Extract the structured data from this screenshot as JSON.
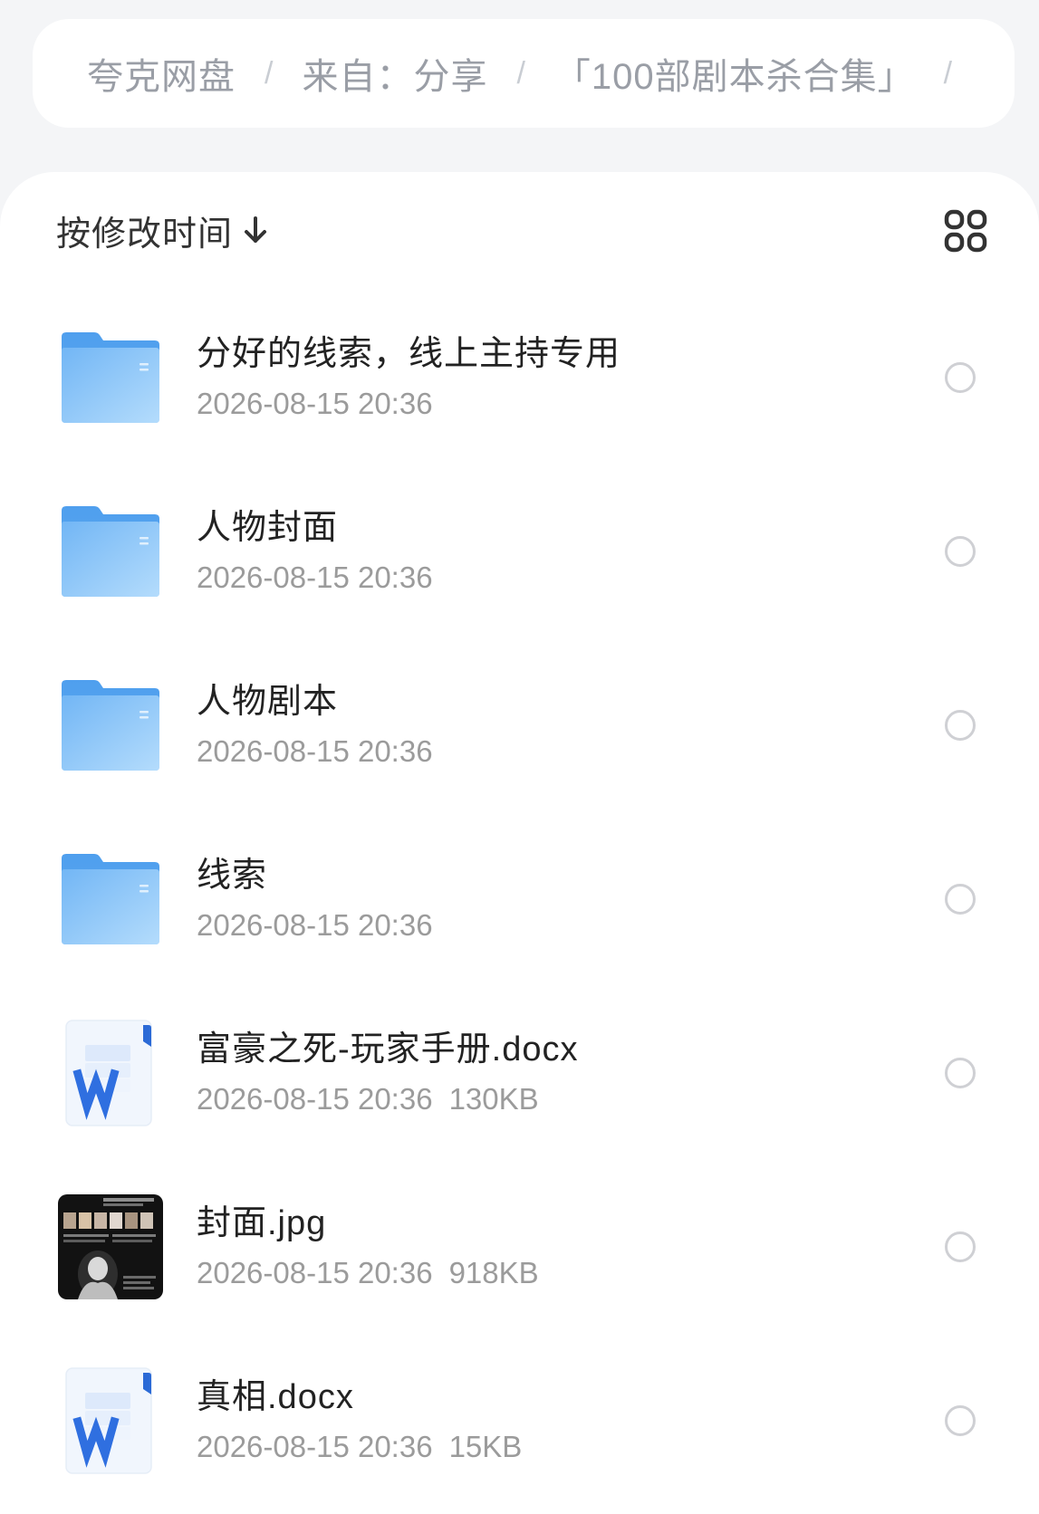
{
  "breadcrumb": {
    "items": [
      "夸克网盘",
      "来自：分享",
      "「100部剧本杀合集」"
    ],
    "separator": "/"
  },
  "toolbar": {
    "sort_label": "按修改时间",
    "sort_icon": "arrow-down-icon",
    "view_icon": "grid-view-icon"
  },
  "files": [
    {
      "type": "folder",
      "icon": "folder-icon",
      "name": "分好的线索，线上主持专用",
      "modified": "2026-08-15 20:36"
    },
    {
      "type": "folder",
      "icon": "folder-icon",
      "name": "人物封面",
      "modified": "2026-08-15 20:36"
    },
    {
      "type": "folder",
      "icon": "folder-icon",
      "name": "人物剧本",
      "modified": "2026-08-15 20:36"
    },
    {
      "type": "folder",
      "icon": "folder-icon",
      "name": "线索",
      "modified": "2026-08-15 20:36"
    },
    {
      "type": "word",
      "icon": "word-document-icon",
      "name": "富豪之死-玩家手册.docx",
      "modified": "2026-08-15 20:36",
      "size": "130KB"
    },
    {
      "type": "image",
      "icon": "image-thumbnail",
      "name": "封面.jpg",
      "modified": "2026-08-15 20:36",
      "size": "918KB"
    },
    {
      "type": "word",
      "icon": "word-document-icon",
      "name": "真相.docx",
      "modified": "2026-08-15 20:36",
      "size": "15KB"
    }
  ],
  "colors": {
    "text_primary": "#222222",
    "text_secondary": "#9b9b9b",
    "folder_blue": "#6fb2f3",
    "word_blue": "#2f6fe0"
  }
}
